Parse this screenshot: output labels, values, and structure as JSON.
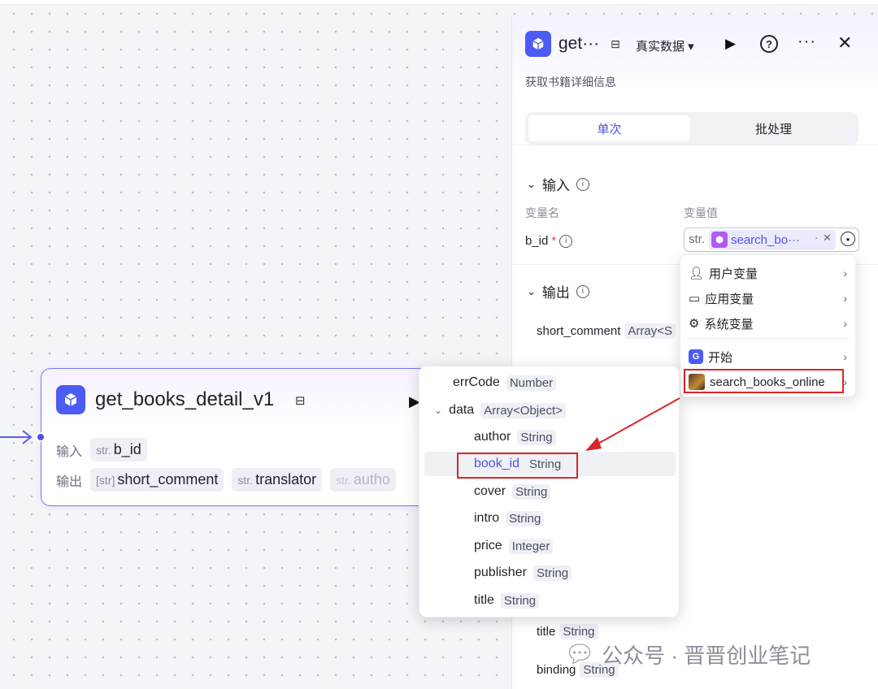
{
  "node": {
    "title": "get_books_detail_v1",
    "input_label": "输入",
    "output_label": "输出",
    "inputs": [
      {
        "type": "str.",
        "name": "b_id"
      }
    ],
    "outputs": [
      {
        "type": "[str]",
        "name": "short_comment"
      },
      {
        "type": "str.",
        "name": "translator"
      },
      {
        "type": "str.",
        "name": "autho"
      }
    ]
  },
  "panel": {
    "title": "get···",
    "data_mode": "真实数据 ▾",
    "description": "获取书籍详细信息",
    "tabs": [
      "单次",
      "批处理"
    ],
    "input_section": "输入",
    "col_name": "变量名",
    "col_value": "变量值",
    "var_name": "b_id",
    "var_required": "*",
    "var_type": "str.",
    "var_ref": "search_bo···",
    "var_dot": "·",
    "output_section": "输出",
    "outputs": [
      {
        "name": "short_comment",
        "type": "Array<S"
      },
      {
        "name": "title",
        "type": "String"
      },
      {
        "name": "binding",
        "type": "String"
      }
    ]
  },
  "var_menu": {
    "items": [
      {
        "label": "用户变量"
      },
      {
        "label": "应用变量"
      },
      {
        "label": "系统变量"
      },
      {
        "label": "开始"
      },
      {
        "label": "search_books_online"
      }
    ]
  },
  "field_dropdown": {
    "rows": [
      {
        "name": "errCode",
        "type": "Number"
      },
      {
        "name": "data",
        "type": "Array<Object>"
      },
      {
        "name": "author",
        "type": "String"
      },
      {
        "name": "book_id",
        "type": "String"
      },
      {
        "name": "cover",
        "type": "String"
      },
      {
        "name": "intro",
        "type": "String"
      },
      {
        "name": "price",
        "type": "Integer"
      },
      {
        "name": "publisher",
        "type": "String"
      },
      {
        "name": "title",
        "type": "String"
      }
    ]
  },
  "watermark": "公众号 · 晋晋创业笔记",
  "colors": {
    "accent": "#4d53e8",
    "highlight_box": "#d8262a",
    "node_border": "#7c75f5"
  }
}
